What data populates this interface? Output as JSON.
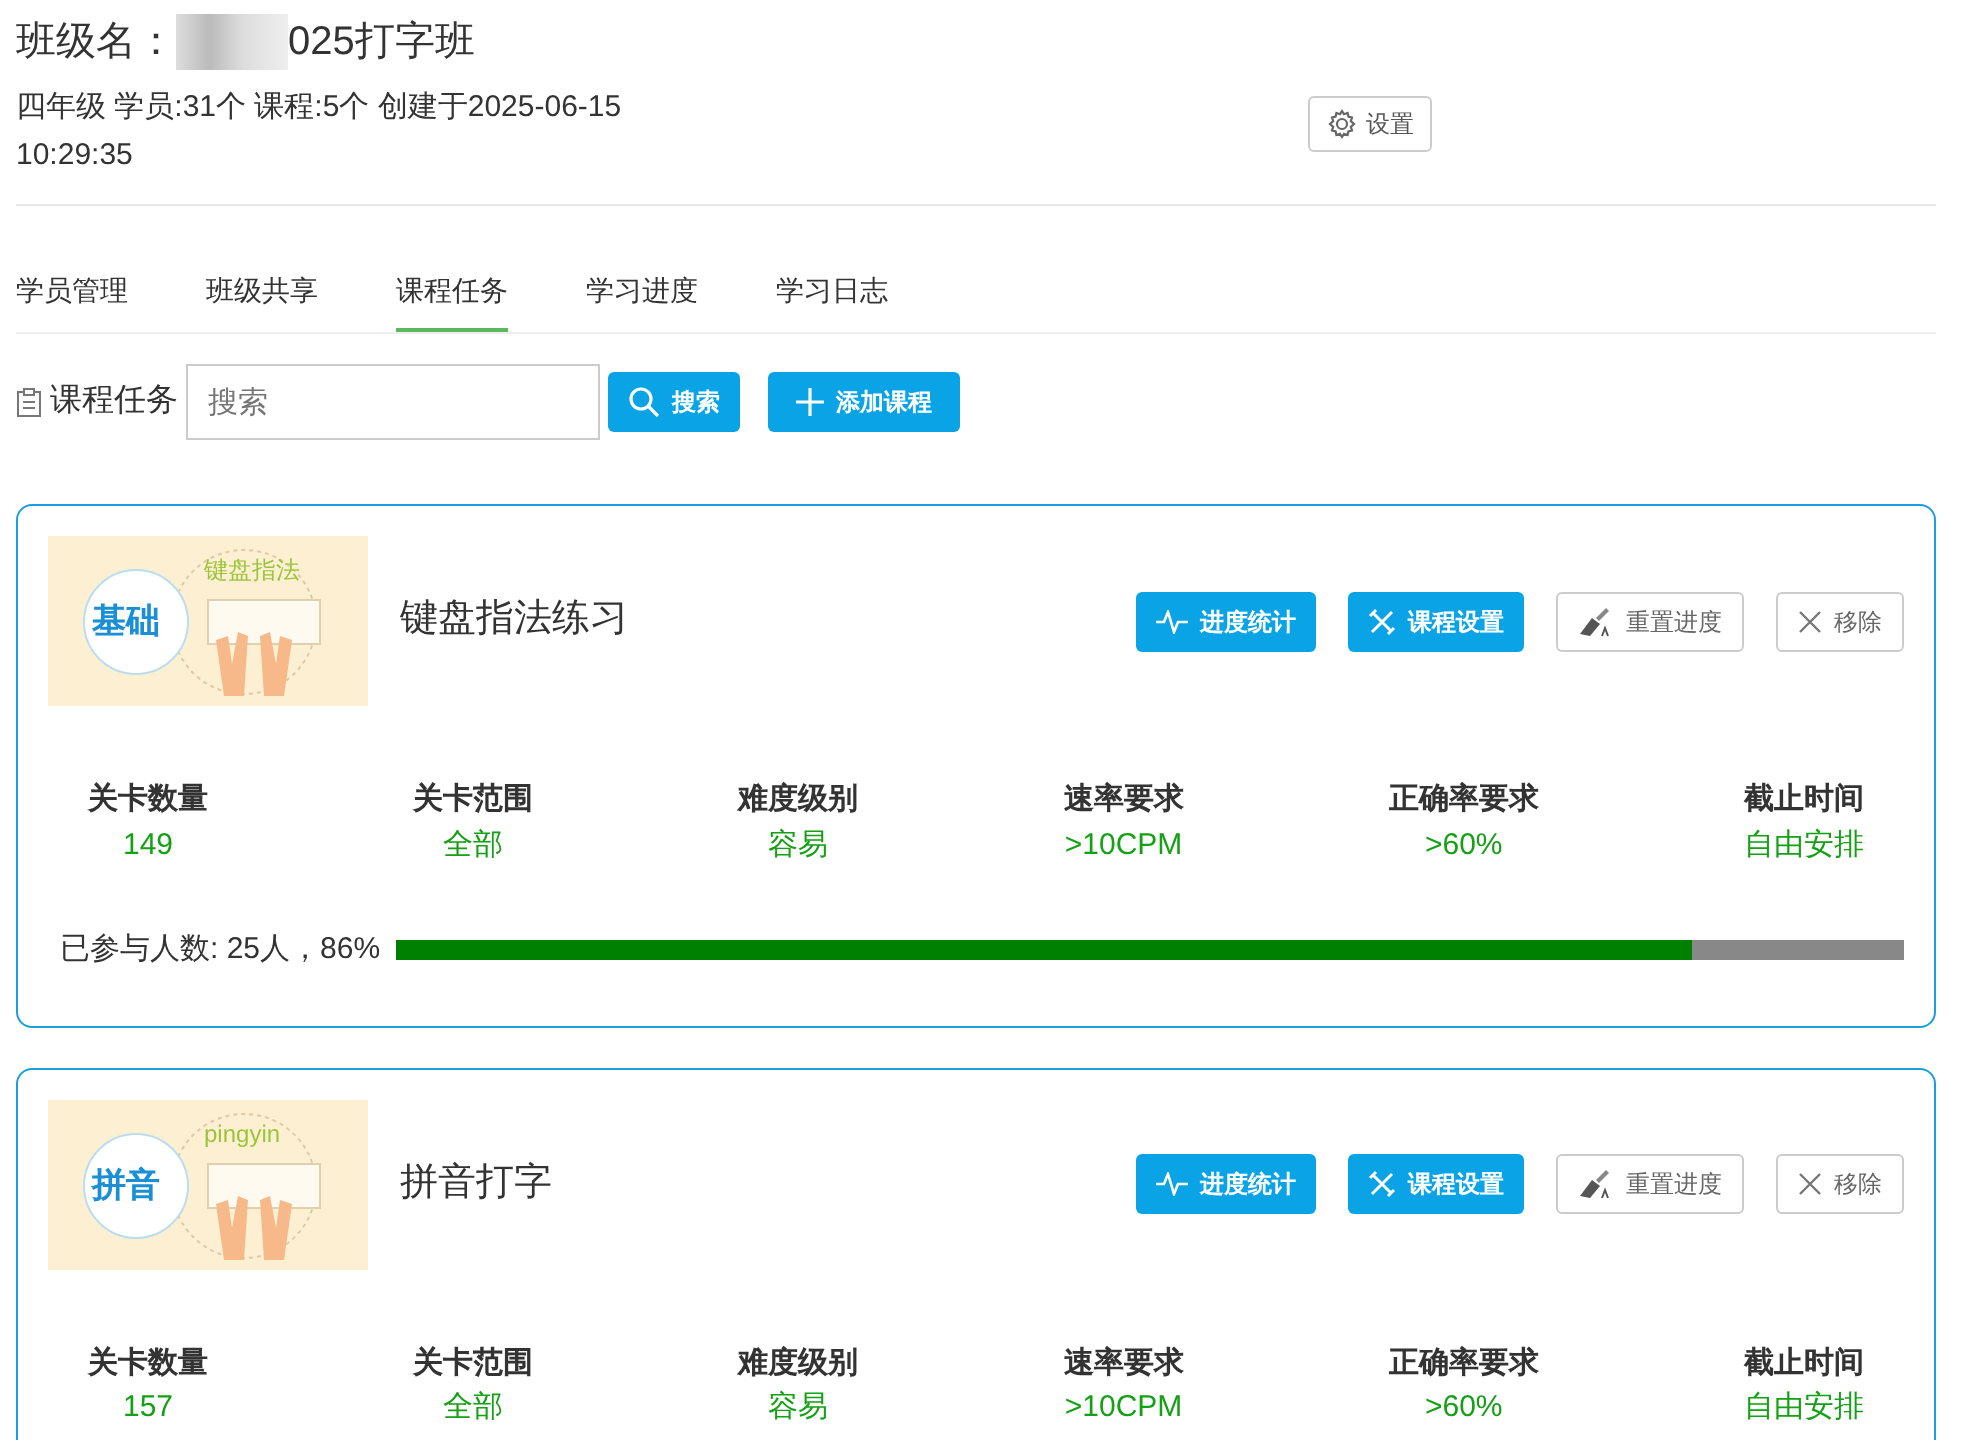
{
  "header": {
    "title_label": "班级名：",
    "title_suffix": "025打字班",
    "meta": "四年级 学员:31个 课程:5个 创建于2025-06-15 10:29:35",
    "settings_button": "设置"
  },
  "tabs": [
    {
      "label": "学员管理",
      "selected": false
    },
    {
      "label": "班级共享",
      "selected": false
    },
    {
      "label": "课程任务",
      "selected": true
    },
    {
      "label": "学习进度",
      "selected": false
    },
    {
      "label": "学习日志",
      "selected": false
    }
  ],
  "toolbar": {
    "title": "课程任务",
    "search": {
      "placeholder": "搜索"
    },
    "search_button": "搜索",
    "add_button": "添加课程"
  },
  "courses": [
    {
      "cover_badge": "基础",
      "cover_caption": "键盘指法",
      "name": "键盘指法练习",
      "buttons": [
        "进度统计",
        "课程设置",
        "重置进度",
        "移除"
      ],
      "stats": [
        {
          "label": "关卡数量",
          "value": "149"
        },
        {
          "label": "关卡范围",
          "value": "全部"
        },
        {
          "label": "难度级别",
          "value": "容易"
        },
        {
          "label": "速率要求",
          "value": ">10CPM"
        },
        {
          "label": "正确率要求",
          "value": ">60%"
        },
        {
          "label": "截止时间",
          "value": "自由安排"
        }
      ],
      "participation": "已参与人数: 25人，86%",
      "level": 0.86
    },
    {
      "cover_badge": "拼音",
      "cover_caption": "pingyin",
      "name": "拼音打字",
      "buttons": [
        "进度统计",
        "课程设置",
        "重置进度",
        "移除"
      ],
      "stats": [
        {
          "label": "关卡数量",
          "value": "157"
        },
        {
          "label": "关卡范围",
          "value": "全部"
        },
        {
          "label": "难度级别",
          "value": "容易"
        },
        {
          "label": "速率要求",
          "value": ">10CPM"
        },
        {
          "label": "正确率要求",
          "value": ">60%"
        },
        {
          "label": "截止时间",
          "value": "自由安排"
        }
      ]
    }
  ]
}
